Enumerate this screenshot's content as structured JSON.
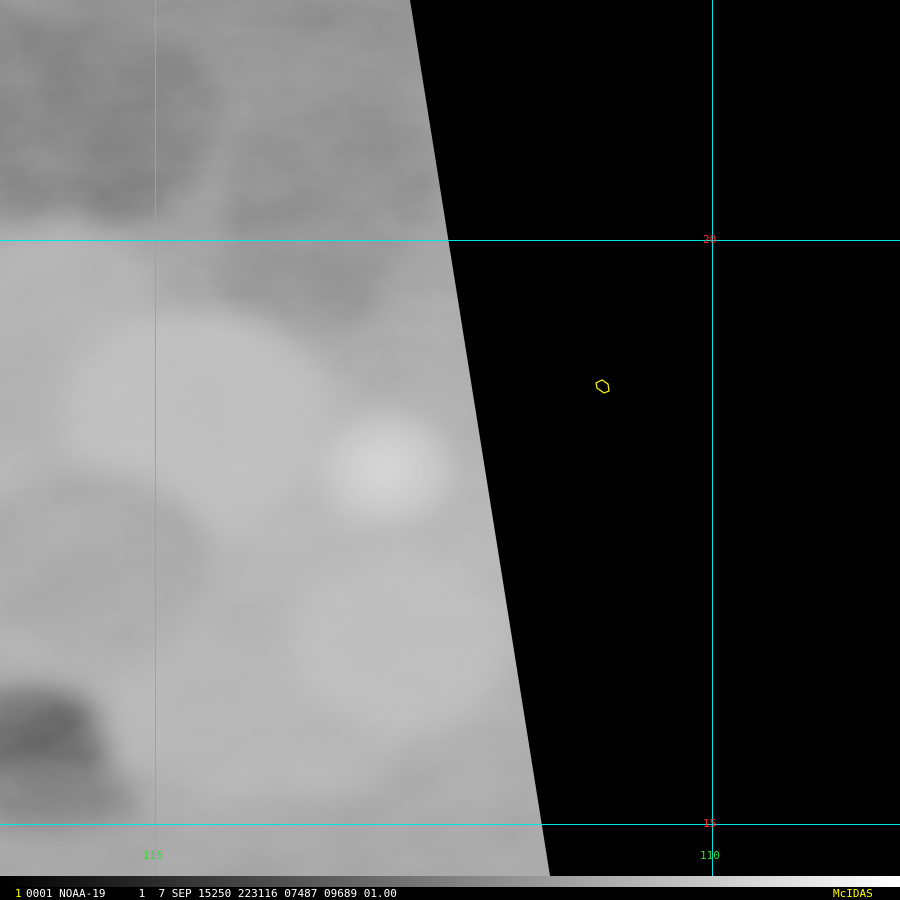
{
  "view": {
    "type": "satellite-image-map",
    "colors": {
      "grid": "#00e5e5",
      "lat_label": "#ff2a2a",
      "lon_label": "#33dd33",
      "coastline": "#ffff00",
      "status_text": "#ffffff",
      "frame_number": "#ffff00",
      "brand": "#ffff00",
      "no_data": "#000000"
    }
  },
  "grid": {
    "latitudes": [
      {
        "label": "20"
      },
      {
        "label": "15"
      }
    ],
    "longitudes": [
      {
        "label": "115"
      },
      {
        "label": "110"
      }
    ]
  },
  "status_bar": {
    "frame_number": "1",
    "text": "0001 NOAA-19     1  7 SEP 15250 223116 07487 09689 01.00",
    "brand": "McIDAS"
  }
}
